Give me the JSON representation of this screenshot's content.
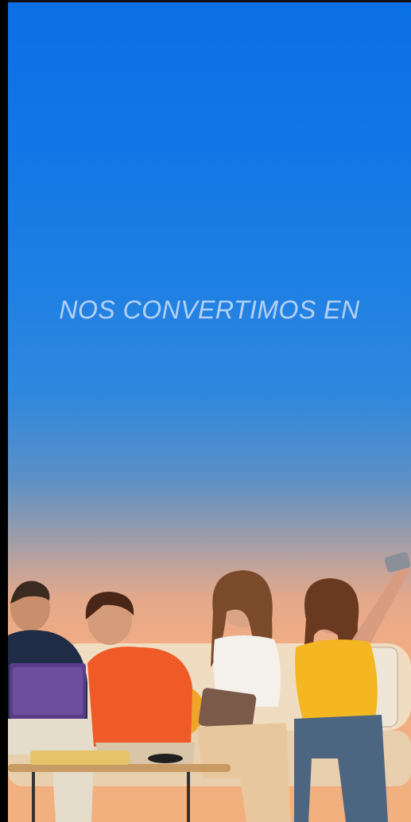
{
  "headline": "NOS CONVERTIMOS EN",
  "colors": {
    "gradient_top": "#0a6fe6",
    "gradient_mid": "#2f88de",
    "gradient_bottom": "#f3ad83"
  },
  "photo": {
    "subject": "family-selfie-on-sofa"
  }
}
